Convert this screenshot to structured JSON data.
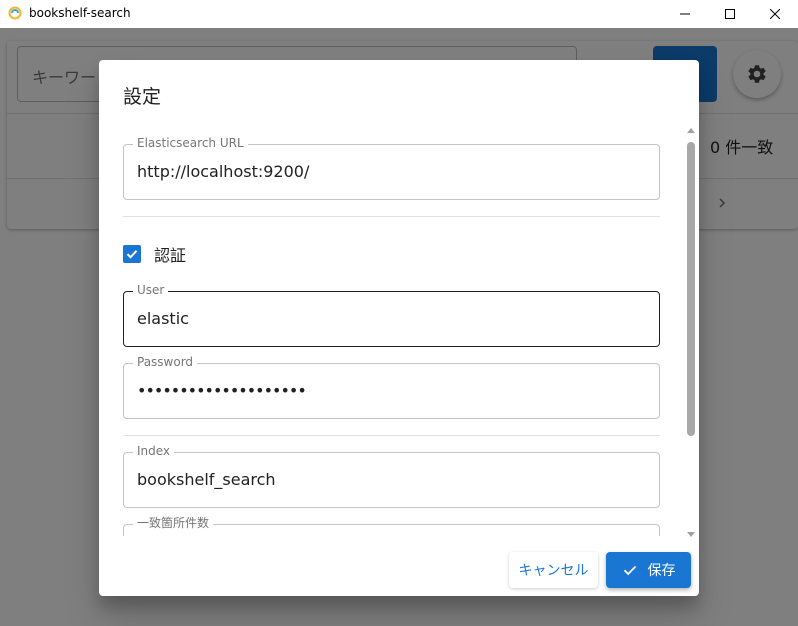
{
  "window": {
    "title": "bookshelf-search",
    "icon": "app-icon"
  },
  "main": {
    "search_placeholder": "キーワー",
    "result_count": "0 件一致"
  },
  "dialog": {
    "title": "設定",
    "fields": {
      "es_url": {
        "label": "Elasticsearch URL",
        "value": "http://localhost:9200/"
      },
      "auth": {
        "label": "認証",
        "checked": true
      },
      "user": {
        "label": "User",
        "value": "elastic"
      },
      "password": {
        "label": "Password",
        "value": "••••••••••••••••••••"
      },
      "index": {
        "label": "Index",
        "value": "bookshelf_search"
      },
      "match_count": {
        "label": "一致箇所件数",
        "value": ""
      }
    },
    "buttons": {
      "cancel": "キャンセル",
      "save": "保存"
    }
  },
  "colors": {
    "primary": "#1976d2",
    "overlay": "rgba(0,0,0,0.5)"
  }
}
